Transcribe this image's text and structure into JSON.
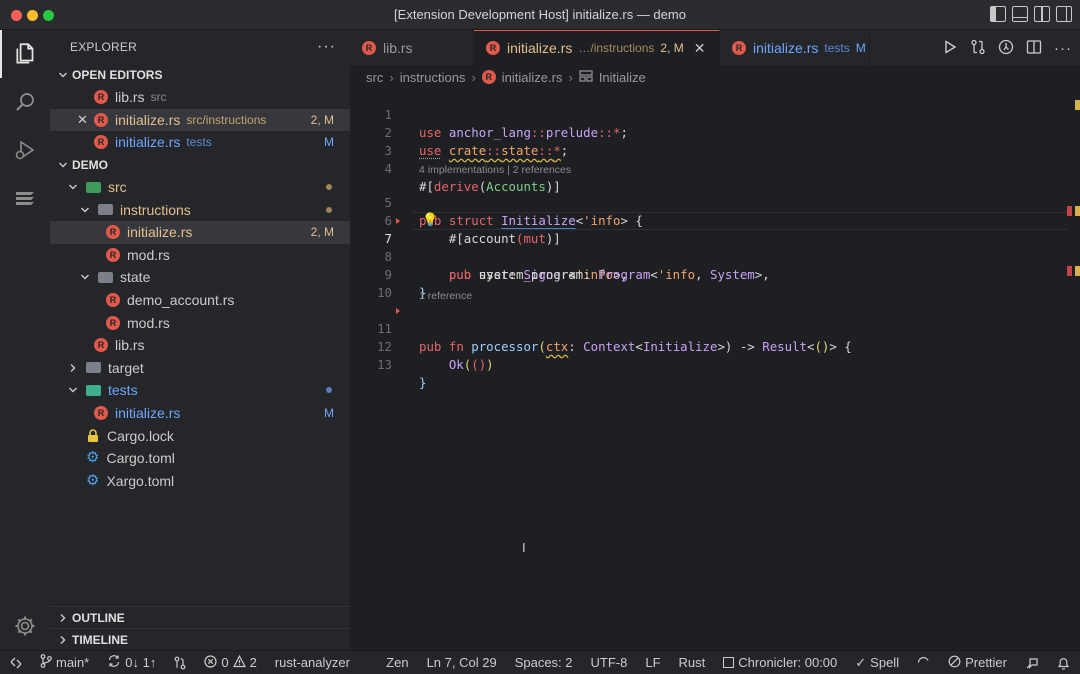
{
  "window": {
    "title": "[Extension Development Host] initialize.rs — demo"
  },
  "activity_bar": {
    "items": [
      "explorer",
      "search",
      "run-and-debug",
      "anchor"
    ],
    "settings": "manage"
  },
  "sidebar": {
    "header": "EXPLORER",
    "more": "···",
    "open_editors": {
      "title": "OPEN EDITORS",
      "items": [
        {
          "name": "lib.rs",
          "desc": "src",
          "badge": ""
        },
        {
          "name": "initialize.rs",
          "desc": "src/instructions",
          "badge": "2, M"
        },
        {
          "name": "initialize.rs",
          "desc": "tests",
          "badge": "M"
        }
      ]
    },
    "workspace": {
      "title": "DEMO",
      "items": [
        {
          "name": "src",
          "badge": ""
        },
        {
          "name": "instructions",
          "badge": ""
        },
        {
          "name": "initialize.rs",
          "badge": "2, M"
        },
        {
          "name": "mod.rs",
          "badge": ""
        },
        {
          "name": "state",
          "badge": ""
        },
        {
          "name": "demo_account.rs",
          "badge": ""
        },
        {
          "name": "mod.rs",
          "badge": ""
        },
        {
          "name": "lib.rs",
          "badge": ""
        },
        {
          "name": "target",
          "badge": ""
        },
        {
          "name": "tests",
          "badge": ""
        },
        {
          "name": "initialize.rs",
          "badge": "M"
        },
        {
          "name": "Cargo.lock",
          "badge": ""
        },
        {
          "name": "Cargo.toml",
          "badge": ""
        },
        {
          "name": "Xargo.toml",
          "badge": ""
        }
      ]
    },
    "outline": "OUTLINE",
    "timeline": "TIMELINE"
  },
  "tabs": [
    {
      "name": "lib.rs",
      "desc": "",
      "badge": ""
    },
    {
      "name": "initialize.rs",
      "desc": "…/instructions",
      "badge": "2, M",
      "close": "✕"
    },
    {
      "name": "initialize.rs",
      "desc": "tests",
      "badge": "M"
    }
  ],
  "breadcrumb": {
    "items": [
      "src",
      "instructions",
      "initialize.rs",
      "Initialize"
    ]
  },
  "code": {
    "lines": [
      "1",
      "2",
      "3",
      "4",
      "5",
      "6",
      "7",
      "8",
      "9",
      "10",
      "11",
      "12",
      "13"
    ],
    "lens_1": "4 implementations | 2 references",
    "lens_2": "1 reference",
    "l1": {
      "a": "use",
      "b": "anchor_lang",
      "c": "::",
      "d": "prelude",
      "e": "::",
      "f": "*",
      "g": ";"
    },
    "l2": {
      "a": "use",
      "b": "crate",
      "c": "::",
      "d": "state",
      "e": "::",
      "f": "*",
      "g": ";"
    },
    "l4": {
      "a": "#[",
      "b": "derive",
      "c": "(",
      "d": "Accounts",
      "e": ")]"
    },
    "l5": {
      "a": "pub",
      "b": "struct",
      "c": "Initialize",
      "d": "<",
      "e": "'info",
      "f": "> {"
    },
    "l6": {
      "a": "#[",
      "b": "account",
      "c": "(",
      "d": "mut",
      "e": ")]"
    },
    "l7": {
      "a": "pub",
      "b": "user",
      "c": ": ",
      "d": "Signer",
      "e": "<",
      "f": "'info",
      "g": ">,"
    },
    "l8": {
      "a": "pub",
      "b": "system_program",
      "c": ": ",
      "d": "Program",
      "e": "<",
      "f": "'info",
      "g": ", ",
      "h": "System",
      "i": ">,"
    },
    "l9": {
      "a": "}"
    },
    "l11": {
      "a": "pub",
      "b": "fn",
      "c": "processor",
      "d": "(",
      "e": "ctx",
      "f": ": ",
      "g": "Context",
      "h": "<",
      "i": "Initialize",
      "j": ">) -> ",
      "k": "Result",
      "l": "<",
      "m": "()",
      "n": "> {"
    },
    "l12": {
      "a": "Ok",
      "b": "(",
      "c": "()",
      "d": ")"
    },
    "l13": {
      "a": "}"
    }
  },
  "statusbar": {
    "branch": "main*",
    "sync": "0↓ 1↑",
    "errors": "0",
    "warnings": "2",
    "analyzer": "rust-analyzer",
    "zen": "Zen",
    "position": "Ln 7, Col 29",
    "spaces": "Spaces: 2",
    "encoding": "UTF-8",
    "eol": "LF",
    "language": "Rust",
    "chronicler": "Chronicler: 00:00",
    "spell": "Spell",
    "prettier": "Prettier"
  },
  "colors": {
    "accent": "#e0594a",
    "modified": "#e2c08d",
    "added": "#6ea6ff",
    "keyword": "#e5646a",
    "type": "#c9a2f5"
  }
}
